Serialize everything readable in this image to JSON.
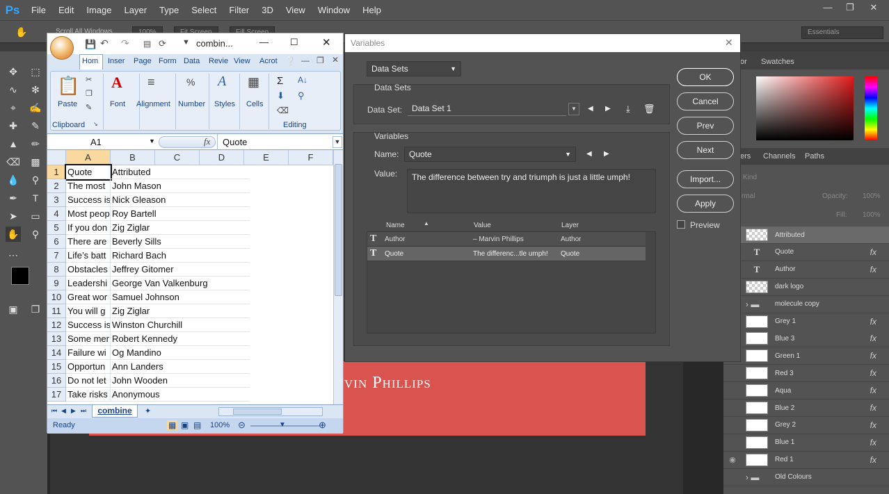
{
  "photoshop": {
    "logo": "Ps",
    "menu": [
      "File",
      "Edit",
      "Image",
      "Layer",
      "Type",
      "Select",
      "Filter",
      "3D",
      "View",
      "Window",
      "Help"
    ],
    "options": {
      "scroll_all": "Scroll All Windows",
      "zoom": "100%",
      "fit": "Fit Screen",
      "fill": "Fill Screen",
      "workspace": "Essentials"
    },
    "right_tabs": {
      "color": "or",
      "swatches": "Swatches",
      "layers": "ers",
      "channels": "Channels",
      "paths": "Paths"
    },
    "layer_filter": {
      "kind": "Kind",
      "blend": "rmal",
      "opacity_label": "Opacity:",
      "opacity": "100%",
      "fill_label": "Fill:",
      "fill": "100%"
    },
    "layers": [
      {
        "name": "Attributed",
        "kind": "checker",
        "fx": false,
        "selected": true
      },
      {
        "name": "Quote",
        "kind": "text",
        "fx": true
      },
      {
        "name": "Author",
        "kind": "text",
        "fx": true
      },
      {
        "name": "dark logo",
        "kind": "checker",
        "fx": false
      },
      {
        "name": "molecule copy",
        "kind": "folder",
        "fx": false
      },
      {
        "name": "Grey 1",
        "kind": "white",
        "fx": true
      },
      {
        "name": "Blue 3",
        "kind": "white",
        "fx": true
      },
      {
        "name": "Green 1",
        "kind": "white",
        "fx": true
      },
      {
        "name": "Red 3",
        "kind": "white",
        "fx": true
      },
      {
        "name": "Aqua",
        "kind": "white",
        "fx": true
      },
      {
        "name": "Blue 2",
        "kind": "white",
        "fx": true
      },
      {
        "name": "Grey 2",
        "kind": "white",
        "fx": true
      },
      {
        "name": "Blue 1",
        "kind": "white",
        "fx": true
      },
      {
        "name": "Red 1",
        "kind": "white",
        "fx": true,
        "visible": true
      },
      {
        "name": "Old Colours",
        "kind": "folder",
        "fx": false
      }
    ],
    "canvas_text": "vin Phillips",
    "fx_label": "fx"
  },
  "variables_dialog": {
    "title": "Variables",
    "mode": "Data Sets",
    "data_sets_group": "Data Sets",
    "data_set_label": "Data Set:",
    "data_set_value": "Data Set 1",
    "variables_group": "Variables",
    "name_label": "Name:",
    "name_value": "Quote",
    "value_label": "Value:",
    "value_text": "The difference between try and triumph is just a little umph!",
    "table_headers": [
      "Name",
      "Value",
      "Layer"
    ],
    "rows": [
      {
        "name": "Author",
        "value": "– Marvin Phillips",
        "layer": "Author"
      },
      {
        "name": "Quote",
        "value": "The differenc...tle umph!",
        "layer": "Quote"
      }
    ],
    "buttons": {
      "ok": "OK",
      "cancel": "Cancel",
      "prev": "Prev",
      "next": "Next",
      "import": "Import...",
      "apply": "Apply"
    },
    "preview_label": "Preview"
  },
  "excel": {
    "title": "combin...",
    "tabs": [
      "Hom",
      "Inser",
      "Page",
      "Form",
      "Data",
      "Revie",
      "View",
      "Acrot"
    ],
    "ribbon": {
      "paste": "Paste",
      "font": "Font",
      "alignment": "Alignment",
      "number": "Number",
      "styles": "Styles",
      "cells": "Cells",
      "clipboard": "Clipboard",
      "editing": "Editing"
    },
    "name_box": "A1",
    "fx_label": "fx",
    "formula": "Quote",
    "columns": [
      "A",
      "B",
      "C",
      "D",
      "E",
      "F"
    ],
    "rows": [
      {
        "n": "1",
        "a": "Quote",
        "b": "Attributed"
      },
      {
        "n": "2",
        "a": "The most",
        "b": "John Mason"
      },
      {
        "n": "3",
        "a": "Success is",
        "b": "Nick Gleason"
      },
      {
        "n": "4",
        "a": "Most peop",
        "b": "Roy Bartell"
      },
      {
        "n": "5",
        "a": "If you don",
        "b": "Zig Ziglar"
      },
      {
        "n": "6",
        "a": "There are",
        "b": "Beverly Sills"
      },
      {
        "n": "7",
        "a": "Life’s batt",
        "b": "Richard Bach"
      },
      {
        "n": "8",
        "a": "Obstacles",
        "b": "Jeffrey Gitomer"
      },
      {
        "n": "9",
        "a": "Leadershi",
        "b": "George Van Valkenburg"
      },
      {
        "n": "10",
        "a": "Great wor",
        "b": "Samuel Johnson"
      },
      {
        "n": "11",
        "a": "You will g",
        "b": "Zig Ziglar"
      },
      {
        "n": "12",
        "a": "Success is",
        "b": "Winston Churchill"
      },
      {
        "n": "13",
        "a": "Some mer",
        "b": "Robert Kennedy"
      },
      {
        "n": "14",
        "a": "Failure wi",
        "b": "Og Mandino"
      },
      {
        "n": "15",
        "a": "Opportun",
        "b": "Ann Landers"
      },
      {
        "n": "16",
        "a": "Do not let",
        "b": "John Wooden"
      },
      {
        "n": "17",
        "a": "Take risks",
        "b": "Anonymous"
      }
    ],
    "sheet_tab": "combine",
    "status": "Ready",
    "zoom": "100%"
  }
}
